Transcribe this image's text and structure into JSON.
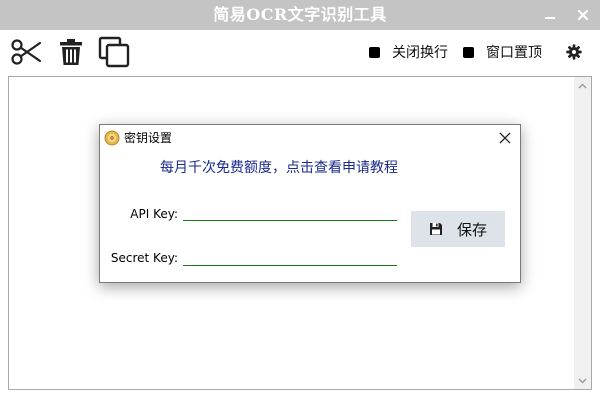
{
  "window": {
    "title": "简易OCR文字识别工具"
  },
  "toolbar": {
    "icons": [
      "scissors-icon",
      "trash-icon",
      "copy-icon",
      "gear-icon"
    ],
    "wrap_toggle_label": "关闭换行",
    "ontop_toggle_label": "窗口置顶"
  },
  "main": {
    "text_value": ""
  },
  "dialog": {
    "title": "密钥设置",
    "link_text": "每月千次免费额度，点击查看申请教程",
    "api_key_label": "API Key:",
    "api_key_value": "",
    "secret_key_label": "Secret Key:",
    "secret_key_value": "",
    "save_label": "保存"
  },
  "colors": {
    "titlebar_bg": "#c4c4c4",
    "link": "#1b2a8c",
    "input_underline": "#1a7a1a",
    "save_button_bg": "#dde3e8"
  }
}
